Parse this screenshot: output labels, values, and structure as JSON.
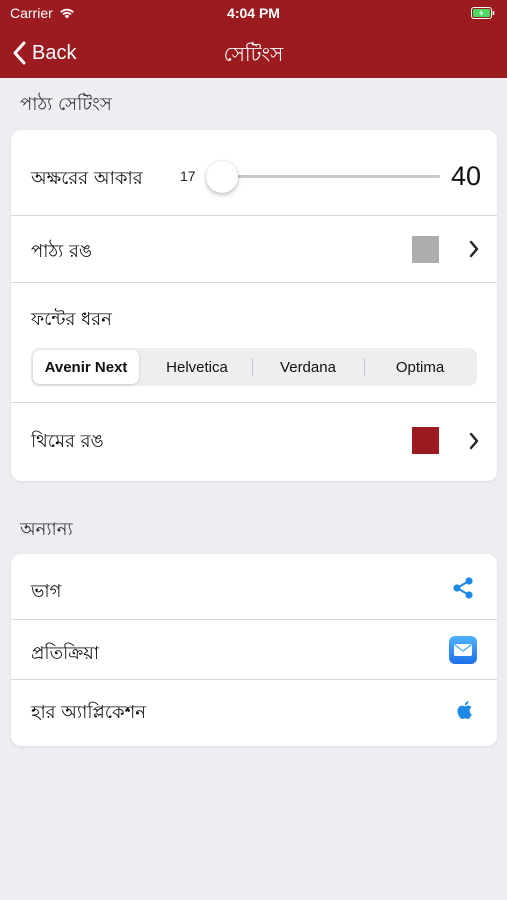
{
  "status_bar": {
    "carrier": "Carrier",
    "time": "4:04 PM"
  },
  "nav": {
    "back_label": "Back",
    "title": "সেটিংস"
  },
  "text_settings": {
    "header": "পাঠ্য সেটিংস",
    "font_size": {
      "label": "অক্ষরের আকার",
      "min": "17",
      "max": "40",
      "value": 17
    },
    "text_color": {
      "label": "পাঠ্য রঙ",
      "swatch_color": "#ADADAD"
    },
    "font_type": {
      "label": "ফন্টের ধরন",
      "options": [
        "Avenir Next",
        "Helvetica",
        "Verdana",
        "Optima"
      ],
      "selected": "Avenir Next"
    },
    "theme_color": {
      "label": "থিমের রঙ",
      "swatch_color": "#9B1B20"
    }
  },
  "other": {
    "header": "অন্যান্য",
    "items": [
      {
        "label": "ভাগ",
        "icon": "share-icon"
      },
      {
        "label": "প্রতিক্রিয়া",
        "icon": "mail-icon"
      },
      {
        "label": "হার অ্যাপ্লিকেশন",
        "icon": "apple-icon"
      }
    ]
  },
  "colors": {
    "accent": "#9B1B20",
    "icon_blue": "#1E88E5",
    "background": "#EEEEF2"
  }
}
